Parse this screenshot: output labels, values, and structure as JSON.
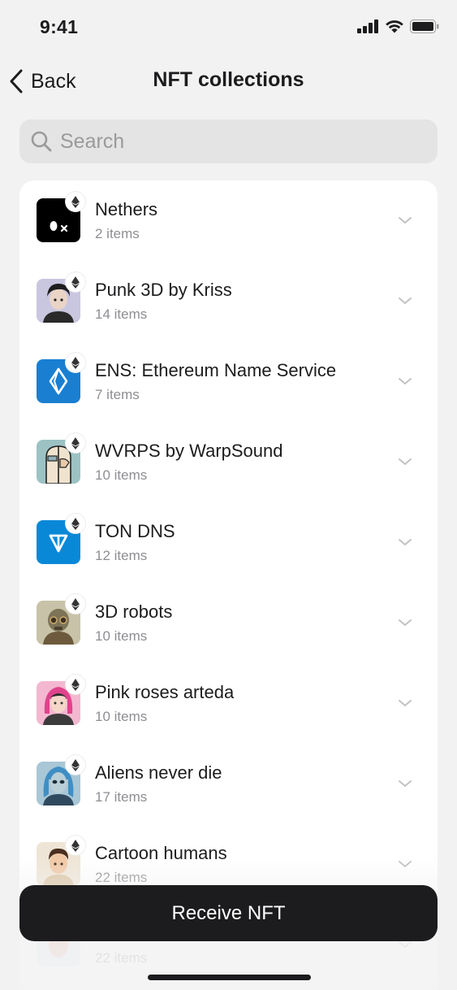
{
  "status_bar": {
    "time": "9:41"
  },
  "nav": {
    "back_label": "Back",
    "title": "NFT collections"
  },
  "search": {
    "placeholder": "Search"
  },
  "collections": [
    {
      "name": "Nethers",
      "count": "2 items",
      "icon": "nethers-logo",
      "chain": "ethereum"
    },
    {
      "name": "Punk 3D by Kriss",
      "count": "14 items",
      "icon": "punk-avatar",
      "chain": "ethereum"
    },
    {
      "name": "ENS: Ethereum Name Service",
      "count": "7 items",
      "icon": "ens-logo",
      "chain": "ethereum"
    },
    {
      "name": "WVRPS by WarpSound",
      "count": "10 items",
      "icon": "wvrps-art",
      "chain": "ethereum"
    },
    {
      "name": "TON DNS",
      "count": "12 items",
      "icon": "ton-logo",
      "chain": "ethereum"
    },
    {
      "name": "3D robots",
      "count": "10 items",
      "icon": "robot-art",
      "chain": "ethereum"
    },
    {
      "name": "Pink roses arteda",
      "count": "10 items",
      "icon": "pink-girl-art",
      "chain": "ethereum"
    },
    {
      "name": "Aliens never die",
      "count": "17 items",
      "icon": "alien-art",
      "chain": "ethereum"
    },
    {
      "name": "Cartoon humans",
      "count": "22 items",
      "icon": "cartoon-human-art",
      "chain": "ethereum"
    },
    {
      "name": "",
      "count": "22 items",
      "icon": "partial-art",
      "chain": "ethereum"
    }
  ],
  "receive_button": {
    "label": "Receive NFT"
  },
  "colors": {
    "background": "#f2f2f2",
    "card": "#ffffff",
    "primary_button": "#1c1c1e",
    "secondary_text": "#8e8e93",
    "ens_blue": "#1a7fd1",
    "ton_blue": "#0a88d8"
  }
}
